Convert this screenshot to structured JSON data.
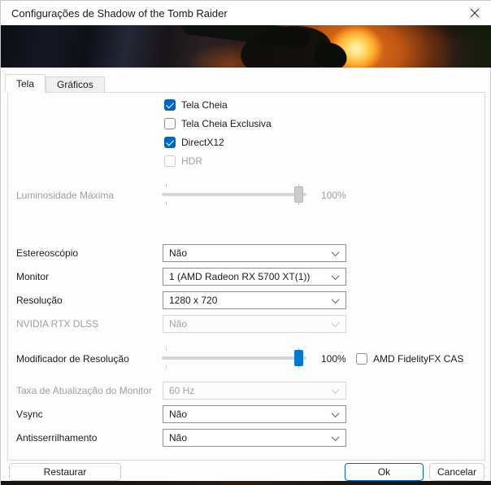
{
  "window": {
    "title": "Configurações de Shadow of the Tomb Raider"
  },
  "icons": {
    "close": "close-x",
    "check": "checkmark",
    "chevron": "chevron-down"
  },
  "banner": {
    "description": "Shadow of the Tomb Raider key art"
  },
  "tabs": {
    "tela": "Tela",
    "graficos": "Gráficos"
  },
  "settings": {
    "tela_cheia": {
      "label": "Tela Cheia",
      "checked": true
    },
    "tela_cheia_exclusiva": {
      "label": "Tela Cheia Exclusiva",
      "checked": false
    },
    "directx12": {
      "label": "DirectX12",
      "checked": true
    },
    "hdr": {
      "label": "HDR",
      "checked": false,
      "disabled": true
    },
    "luminosidade_maxima": {
      "label": "Luminosidade Máxima",
      "value": "100%",
      "slider_percent": 100,
      "disabled": true
    },
    "estereoscopio": {
      "label": "Estereoscópio",
      "value": "Não"
    },
    "monitor": {
      "label": "Monitor",
      "value": "1 (AMD Radeon RX 5700 XT(1))"
    },
    "resolucao": {
      "label": "Resolução",
      "value": "1280 x 720"
    },
    "nvidia_rtx_dlss": {
      "label": "NVIDIA RTX DLSS",
      "value": "Não",
      "disabled": true
    },
    "modificador_resolucao": {
      "label": "Modificador de Resolução",
      "value": "100%",
      "slider_percent": 100
    },
    "amd_fidelityfx_cas": {
      "label": "AMD FidelityFX CAS",
      "checked": false
    },
    "taxa_atualizacao": {
      "label": "Taxa de Atualização do Monitor",
      "value": "60 Hz",
      "disabled": true
    },
    "vsync": {
      "label": "Vsync",
      "value": "Não"
    },
    "antisserrilhamento": {
      "label": "Antisserrilhamento",
      "value": "Não"
    }
  },
  "footer": {
    "restaurar": "Restaurar",
    "ok": "Ok",
    "cancelar": "Cancelar"
  },
  "colors": {
    "accent": "#0067c0",
    "slider_thumb": "#0078d4",
    "sun_core": "#ffd964",
    "sun_glow": "#e26412"
  }
}
